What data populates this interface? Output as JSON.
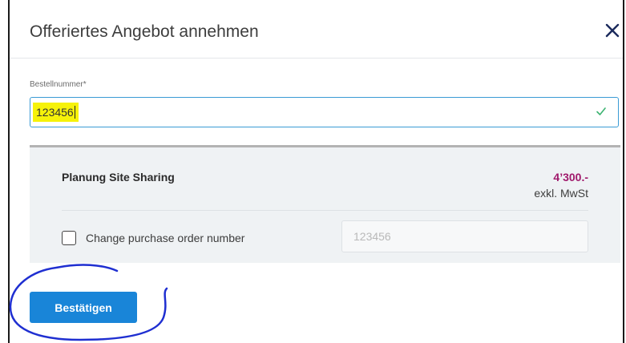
{
  "dialog": {
    "title": "Offeriertes Angebot annehmen",
    "close_icon": "close-icon"
  },
  "order_field": {
    "label": "Bestellnummer*",
    "value": "123456",
    "valid_icon": "check-icon"
  },
  "summary": {
    "product_name": "Planung Site Sharing",
    "price": "4’300.-",
    "price_note": "exkl. MwSt",
    "change_po_label": "Change purchase order number",
    "change_po_checked": false,
    "po_input_value": "123456"
  },
  "actions": {
    "confirm_label": "Bestätigen"
  },
  "colors": {
    "accent": "#1985d8",
    "price": "#a0196b",
    "highlight": "#f6f20a",
    "annotation": "#1f2fd1"
  }
}
